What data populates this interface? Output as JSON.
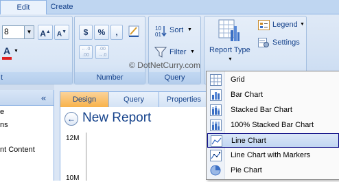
{
  "tabs": [
    {
      "label": "Edit",
      "active": true
    },
    {
      "label": "Create",
      "active": false
    }
  ],
  "ribbon": {
    "font": {
      "size_value": "8",
      "grow_label": "A",
      "shrink_label": "A",
      "color_label": "A"
    },
    "number": {
      "currency_label": "$",
      "percent_label": "%",
      "comma_label": ",",
      "dec_inc_label": "←.0 .00",
      "dec_dec_label": ".00 →.0",
      "group_label": "Number"
    },
    "query": {
      "sort_label": "Sort",
      "filter_label": "Filter",
      "group_label": "Query"
    },
    "report": {
      "report_type_label": "Report Type",
      "legend_label": "Legend",
      "settings_label": "Settings"
    },
    "font_group_tail": "t"
  },
  "watermark": "© DotNetCurry.com",
  "left_pane": {
    "collapse_glyph": "«",
    "items": [
      "e",
      "ns",
      "",
      "nt Content"
    ]
  },
  "doc_tabs": [
    {
      "label": "Design",
      "active": true
    },
    {
      "label": "Query",
      "active": false
    },
    {
      "label": "Properties",
      "active": false
    }
  ],
  "report": {
    "title": "New Report",
    "back_glyph": "←"
  },
  "chart_data": {
    "type": "line",
    "y_ticks": [
      "12M",
      "10M"
    ]
  },
  "menu": {
    "items": [
      {
        "label": "Grid",
        "icon": "grid-icon",
        "selected": false
      },
      {
        "label": "Bar Chart",
        "icon": "bar-chart-icon",
        "selected": false
      },
      {
        "label": "Stacked Bar Chart",
        "icon": "stacked-bar-chart-icon",
        "selected": false
      },
      {
        "label": "100% Stacked Bar Chart",
        "icon": "stacked-100-bar-chart-icon",
        "selected": false
      },
      {
        "label": "Line Chart",
        "icon": "line-chart-icon",
        "selected": true
      },
      {
        "label": "Line Chart with Markers",
        "icon": "line-markers-chart-icon",
        "selected": false
      },
      {
        "label": "Pie Chart",
        "icon": "pie-chart-icon",
        "selected": false
      }
    ]
  },
  "colors": {
    "accent_orange": "#f8b24a",
    "ribbon_blue": "#d4e2f4",
    "text_blue": "#15428b"
  }
}
